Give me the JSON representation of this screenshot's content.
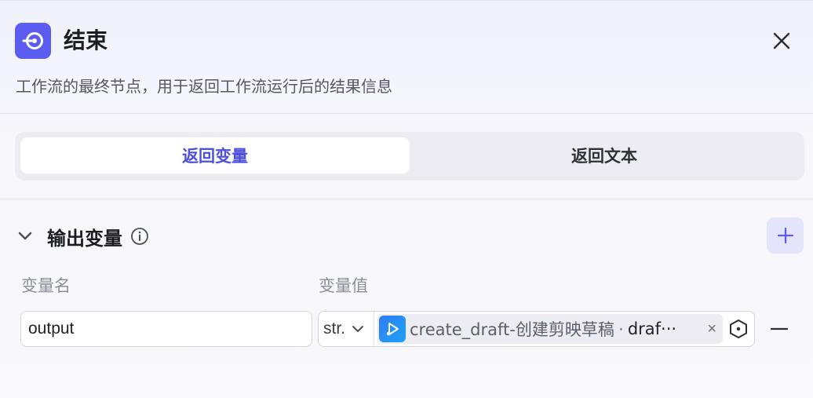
{
  "header": {
    "icon": "end-node-icon",
    "title": "结束",
    "close_icon": "close-icon",
    "description": "工作流的最终节点，用于返回工作流运行后的结果信息"
  },
  "mode_tabs": {
    "options": [
      "返回变量",
      "返回文本"
    ],
    "selected": "返回变量"
  },
  "output_section": {
    "title": "输出变量",
    "info_icon": "info-icon",
    "add_icon": "plus-icon",
    "columns": {
      "name": "变量名",
      "value": "变量值"
    },
    "rows": [
      {
        "name": "output",
        "type": "str.",
        "ref_node": "create_draft-创建剪映草稿",
        "separator": "·",
        "ref_var": "draf···",
        "remove_icon": "minus-icon"
      }
    ]
  },
  "colors": {
    "accent": "#5b5cf2",
    "tab_active_text": "#4d4fe0",
    "add_button_bg": "#e4e4fb",
    "ref_icon": "#2f7cf6"
  }
}
